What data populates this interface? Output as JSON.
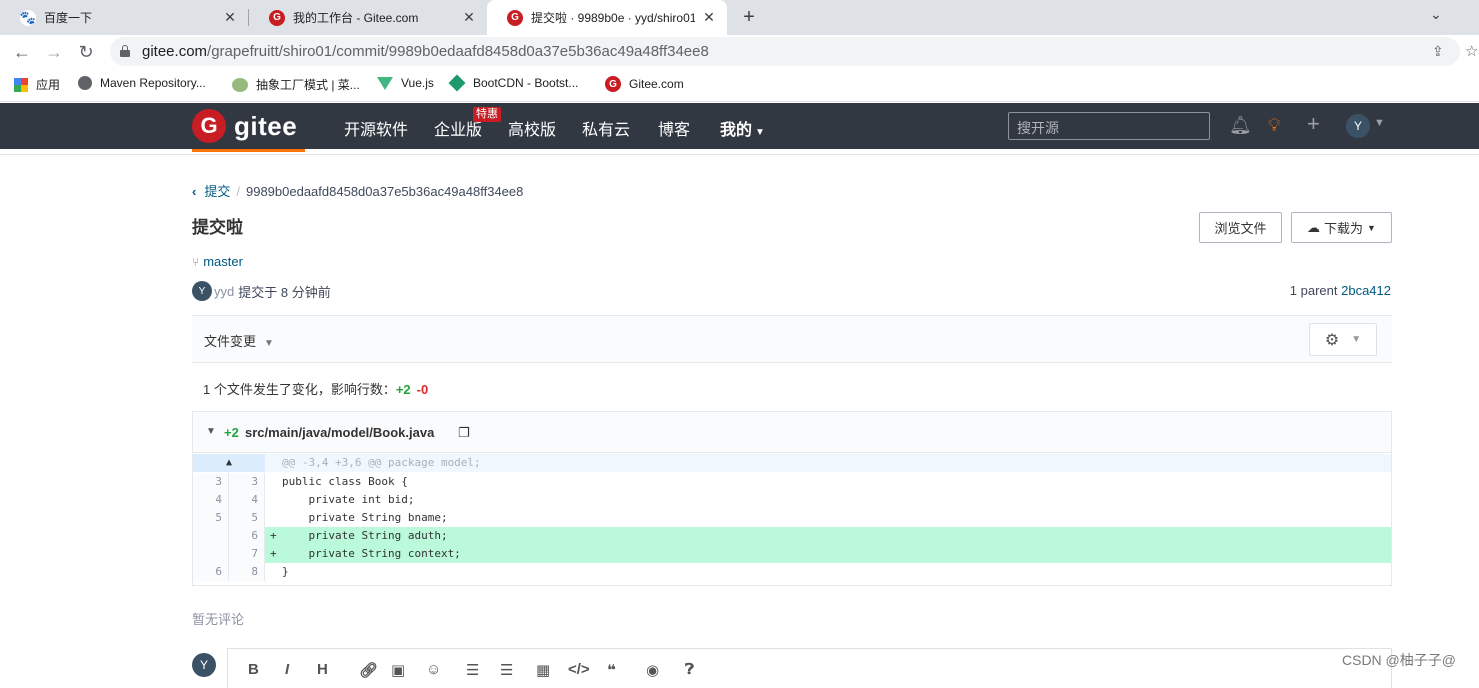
{
  "browser": {
    "tabs": [
      {
        "title": "百度一下",
        "icon": "baidu-paw-icon"
      },
      {
        "title": "我的工作台 - Gitee.com",
        "icon": "gitee-icon"
      },
      {
        "title": "提交啦 · 9989b0e · yyd/shiro01",
        "icon": "gitee-icon"
      }
    ],
    "close_glyph": "✕",
    "new_tab_glyph": "+",
    "url_host": "gitee.com",
    "url_path": "/grapefruitt/shiro01/commit/9989b0edaafd8458d0a37e5b36ac49a48ff34ee8",
    "bookmarks": [
      {
        "label": "应用",
        "icon": "apps-grid-icon"
      },
      {
        "label": "Maven Repository...",
        "icon": "globe-icon"
      },
      {
        "label": "抽象工厂模式 | 菜...",
        "icon": "runoob-icon"
      },
      {
        "label": "Vue.js",
        "icon": "vue-icon"
      },
      {
        "label": "BootCDN - Bootst...",
        "icon": "bootcdn-icon"
      },
      {
        "label": "Gitee.com",
        "icon": "gitee-icon"
      }
    ]
  },
  "gitee": {
    "logo_text": "gitee",
    "nav": [
      "开源软件",
      "企业版",
      "高校版",
      "私有云",
      "博客",
      "我的"
    ],
    "hot_badge": "特惠",
    "search_placeholder": "搜开源",
    "user_initial": "Y",
    "colors": {
      "brand": "#c71d23",
      "header_bg": "#323842",
      "accent": "#fe7300"
    }
  },
  "commit": {
    "breadcrumb_link": "提交",
    "breadcrumb_hash": "9989b0edaafd8458d0a37e5b36ac49a48ff34ee8",
    "title": "提交啦",
    "browse_files": "浏览文件",
    "download": "下载为",
    "branch": "master",
    "author_initial": "Y",
    "author": "yyd",
    "committed_text": "提交于 8 分钟前",
    "parent_label": "1 parent",
    "parent_hash": "2bca412"
  },
  "files": {
    "label": "文件变更",
    "stats_prefix": "1 个文件发生了变化，影响行数：",
    "added": "+2",
    "deleted": "-0"
  },
  "diff": {
    "count": "+2",
    "filename": "src/main/java/model/Book.java",
    "hunk": "@@ -3,4 +3,6 @@ package model;",
    "lines": [
      {
        "old": "3",
        "new": "3",
        "mark": "",
        "code": "public class Book {",
        "type": "ctx"
      },
      {
        "old": "4",
        "new": "4",
        "mark": "",
        "code": "    private int bid;",
        "type": "ctx"
      },
      {
        "old": "5",
        "new": "5",
        "mark": "",
        "code": "    private String bname;",
        "type": "ctx"
      },
      {
        "old": "",
        "new": "6",
        "mark": "+",
        "code": "    private String aduth;",
        "type": "add"
      },
      {
        "old": "",
        "new": "7",
        "mark": "+",
        "code": "    private String context;",
        "type": "add"
      },
      {
        "old": "6",
        "new": "8",
        "mark": "",
        "code": "}",
        "type": "ctx"
      }
    ]
  },
  "comments": {
    "empty_text": "暂无评论",
    "user_initial": "Y",
    "toolbar": [
      "B",
      "I",
      "H",
      "link",
      "image",
      "emoji",
      "ul",
      "ol",
      "table",
      "code",
      "quote",
      "preview",
      "help"
    ]
  },
  "watermark": "CSDN @柚子子@"
}
